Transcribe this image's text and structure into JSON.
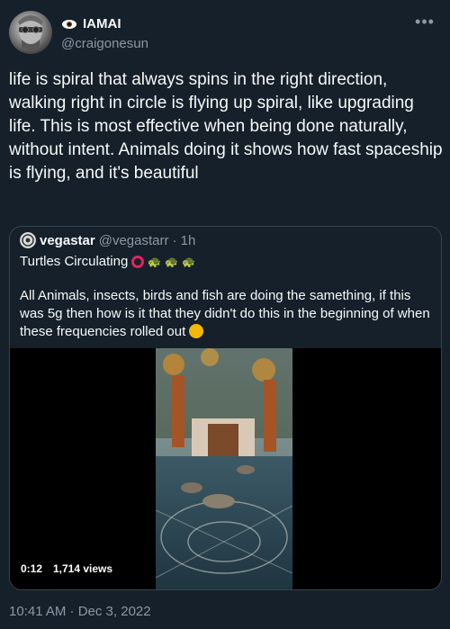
{
  "author": {
    "display_name": "IAMAI",
    "handle": "@craigonesun",
    "name_icon": "eye-icon"
  },
  "tweet": {
    "text": "life is spiral that always spins in the right direction, walking right in circle is flying up spiral, like upgrading life. This is most effective when being done naturally, without intent. Animals doing it shows how fast spaceship is flying, and it's beautiful",
    "timestamp": "10:41 AM · Dec 3, 2022"
  },
  "quoted": {
    "display_name": "vegastar",
    "handle": "@vegastarr",
    "age": "· 1h",
    "title": "Turtles Circulating",
    "title_icons": [
      "red-circle-icon",
      "turtle-icon",
      "turtle-icon",
      "turtle-icon"
    ],
    "body": "All Animals, insects, birds and fish are doing the samething, if this was 5g then how is it that they didn't do this in the beginning of when these frequencies rolled out",
    "body_icon": "thinking-face-icon",
    "video": {
      "duration": "0:12",
      "views": "1,714 views"
    }
  },
  "colors": {
    "background": "#15202b",
    "text": "#f7f9f9",
    "muted": "#8b98a5",
    "border": "#38444d"
  }
}
